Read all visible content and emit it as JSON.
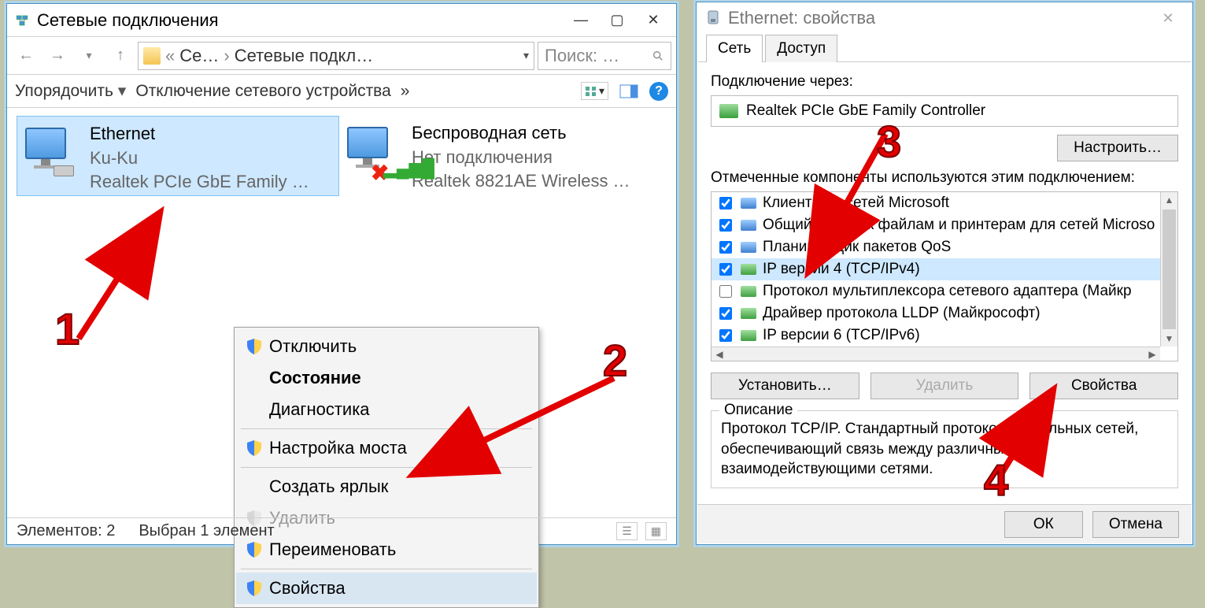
{
  "left": {
    "title": "Сетевые подключения",
    "breadcrumb": {
      "short": "Се…",
      "current": "Сетевые подкл…"
    },
    "search_placeholder": "Поиск: …",
    "toolbar": {
      "organize": "Упорядочить",
      "disable": "Отключение сетевого устройства",
      "overflow": "»"
    },
    "connections": [
      {
        "name": "Ethernet",
        "status": "Ku-Ku",
        "adapter": "Realtek PCIe GbE Family …"
      },
      {
        "name": "Беспроводная сеть",
        "status": "Нет подключения",
        "adapter": "Realtek 8821AE Wireless …"
      }
    ],
    "context_menu": {
      "disable": "Отключить",
      "status": "Состояние",
      "diagnostics": "Диагностика",
      "bridge": "Настройка моста",
      "shortcut": "Создать ярлык",
      "delete": "Удалить",
      "rename": "Переименовать",
      "properties": "Свойства"
    },
    "statusbar": {
      "count": "Элементов: 2",
      "selected": "Выбран 1 элемент"
    }
  },
  "right": {
    "title": "Ethernet: свойства",
    "tabs": {
      "network": "Сеть",
      "access": "Доступ"
    },
    "connect_via_label": "Подключение через:",
    "adapter": "Realtek PCIe GbE Family Controller",
    "configure": "Настроить…",
    "components_label": "Отмеченные компоненты используются этим подключением:",
    "components": [
      {
        "checked": true,
        "type": "blue",
        "label": "Клиент для сетей Microsoft"
      },
      {
        "checked": true,
        "type": "blue",
        "label": "Общий доступ к файлам и принтерам для сетей Microso"
      },
      {
        "checked": true,
        "type": "blue",
        "label": "Планировщик пакетов QoS"
      },
      {
        "checked": true,
        "type": "green",
        "label": "IP версии 4 (TCP/IPv4)",
        "selected": true
      },
      {
        "checked": false,
        "type": "green",
        "label": "Протокол мультиплексора сетевого адаптера (Майкр"
      },
      {
        "checked": true,
        "type": "green",
        "label": "Драйвер протокола LLDP (Майкрософт)"
      },
      {
        "checked": true,
        "type": "green",
        "label": "IP версии 6 (TCP/IPv6)"
      }
    ],
    "buttons": {
      "install": "Установить…",
      "remove": "Удалить",
      "properties": "Свойства"
    },
    "description_label": "Описание",
    "description_text": "Протокол TCP/IP. Стандартный протокол глобальных сетей, обеспечивающий связь между различными взаимодействующими сетями.",
    "ok": "ОК",
    "cancel": "Отмена"
  },
  "anno": {
    "n1": "1",
    "n2": "2",
    "n3": "3",
    "n4": "4"
  }
}
